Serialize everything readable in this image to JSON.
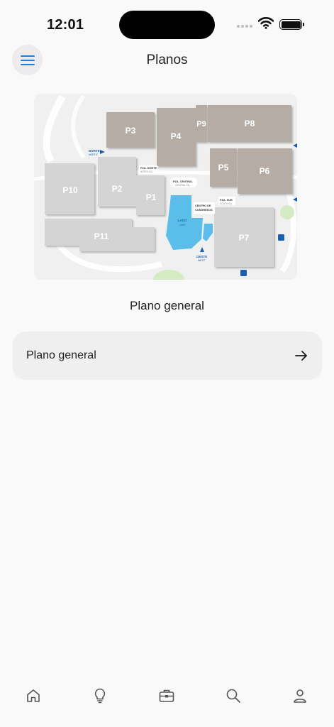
{
  "status_bar": {
    "time": "12:01",
    "icons": [
      "signal-dots-icon",
      "wifi-icon",
      "battery-icon"
    ]
  },
  "header": {
    "menu_icon": "hamburger-menu-icon",
    "title": "Planos"
  },
  "map": {
    "caption": "Plano general",
    "pavilions": [
      "P1",
      "P2",
      "P3",
      "P4",
      "P5",
      "P6",
      "P7",
      "P8",
      "P9",
      "P10",
      "P11"
    ],
    "labels": {
      "norte": "NORTE",
      "north": "NORTH",
      "pza_norte": "PZA. NORTE",
      "north_sq": "NORTH SQ.",
      "pza_central": "PZA. CENTRAL",
      "central_sq": "CENTRAL SQ.",
      "pza_sur": "PZA. SUR",
      "south_sq": "SOUTH SQ.",
      "centro_de": "CENTRO DE",
      "congresos": "CONGRESOS",
      "lago": "LAGO",
      "lake": "LAKE",
      "oeste": "OESTE",
      "west": "WEST"
    },
    "colors": {
      "background": "#f0f0f0",
      "hall_dark": "#b5ada5",
      "hall_light": "#d4d4d4",
      "lake": "#5bbdea",
      "accent": "#1b5fb0",
      "green": "#d4ebc4"
    }
  },
  "plan_item": {
    "label": "Plano general",
    "icon": "arrow-right-icon"
  },
  "tab_bar": {
    "tabs": [
      {
        "icon": "home-icon"
      },
      {
        "icon": "lightbulb-icon"
      },
      {
        "icon": "briefcase-icon"
      },
      {
        "icon": "search-icon"
      },
      {
        "icon": "user-icon"
      }
    ]
  },
  "accent_color": "#1f7fd6"
}
